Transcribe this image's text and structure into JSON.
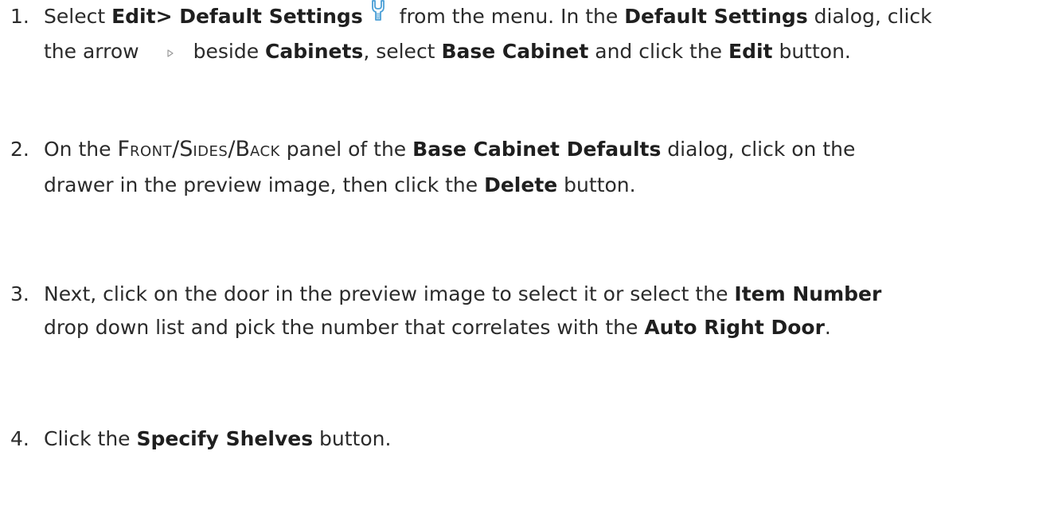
{
  "steps": [
    {
      "number": "1.",
      "parts": {
        "a": "Select ",
        "b": "Edit> Default Settings",
        "c": " from the menu. In the ",
        "d": "Default Settings",
        "e": " dialog, click",
        "f": "the arrow",
        "g": "beside ",
        "h": "Cabinets",
        "i": ", select ",
        "j": "Base Cabinet",
        "k": " and click the ",
        "l": "Edit",
        "m": " button."
      },
      "icons": [
        "default-settings-icon",
        "tree-arrow-icon"
      ]
    },
    {
      "number": "2.",
      "parts": {
        "a": "On the ",
        "sc1_big": "F",
        "sc1_small": "RONT",
        "slash1": "/",
        "sc2_big": "S",
        "sc2_small": "IDES",
        "slash2": "/",
        "sc3_big": "B",
        "sc3_small": "ACK",
        "b": " panel of the ",
        "c": "Base Cabinet Defaults",
        "d": " dialog, click on the",
        "e": "drawer in the preview image, then click the ",
        "f": "Delete",
        "g": " button."
      }
    },
    {
      "number": "3.",
      "parts": {
        "a": "Next, click on the door in the preview image to select it or select the ",
        "b": "Item Number",
        "c": "drop down list and pick the number that correlates with the ",
        "d": "Auto Right Door",
        "e": "."
      }
    },
    {
      "number": "4.",
      "parts": {
        "a": "Click the ",
        "b": "Specify Shelves",
        "c": " button."
      }
    }
  ],
  "colors": {
    "text": "#2b2b2b",
    "icon_blue": "#4a9fd6"
  }
}
